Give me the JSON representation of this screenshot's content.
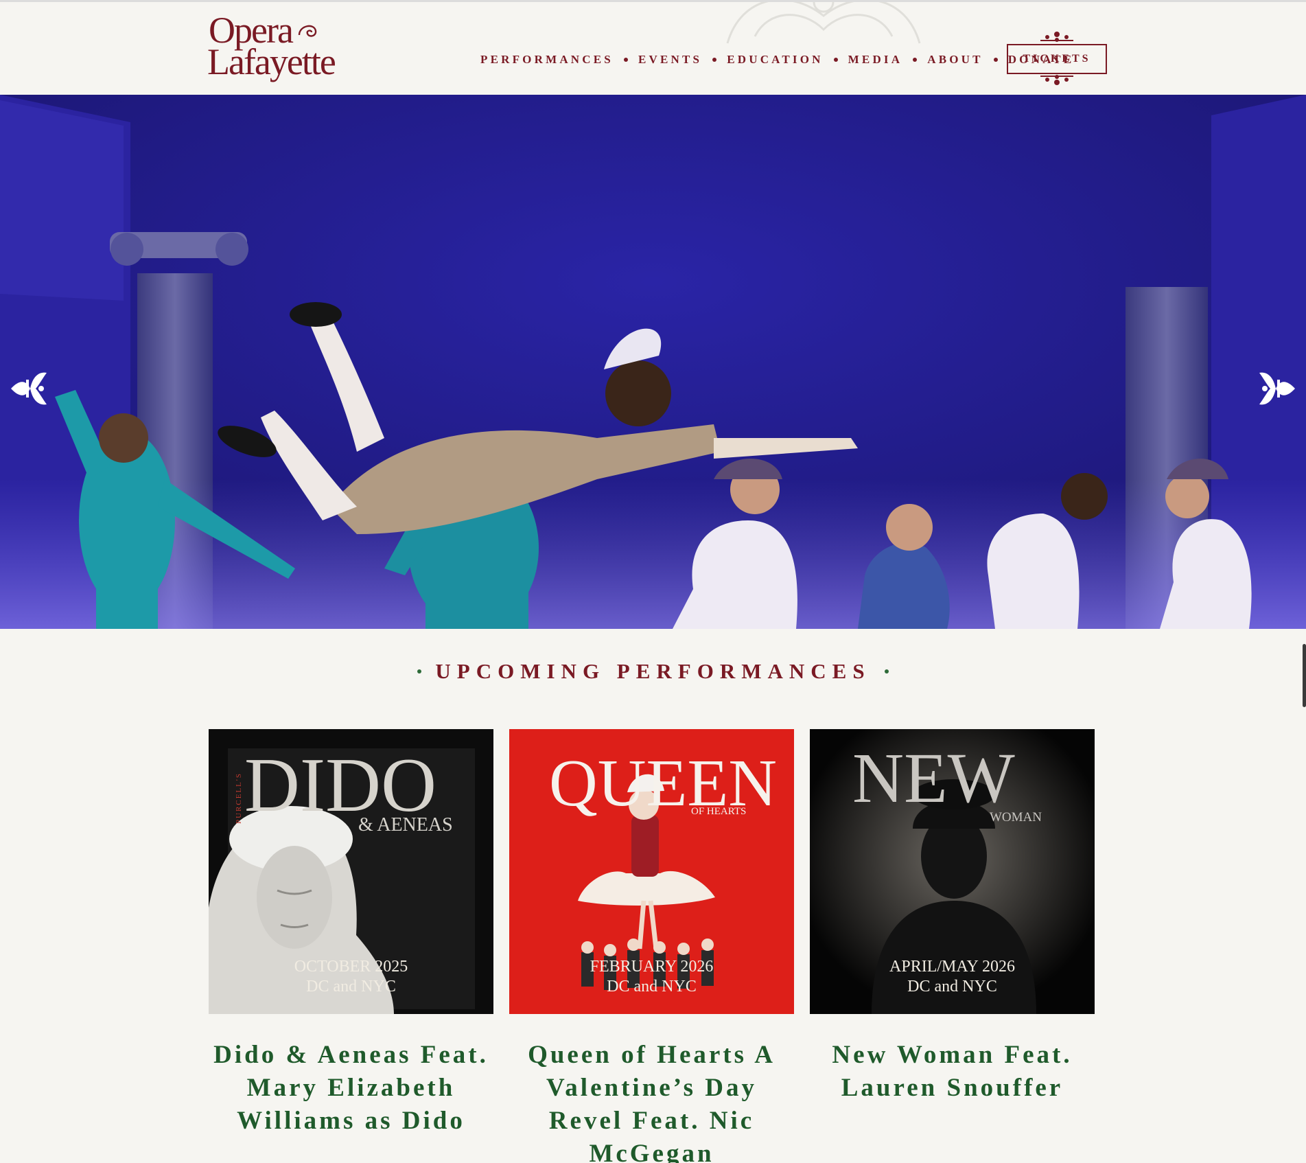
{
  "brand": {
    "logo_line1": "Opera",
    "logo_line2": "Lafayette"
  },
  "nav": {
    "items": [
      "PERFORMANCES",
      "EVENTS",
      "EDUCATION",
      "MEDIA",
      "ABOUT",
      "DONATE"
    ],
    "tickets_label": "TICKETS"
  },
  "hero": {
    "prev_icon": "fleur-de-lis-left-arrow",
    "next_icon": "fleur-de-lis-right-arrow"
  },
  "upcoming": {
    "heading": "UPCOMING PERFORMANCES",
    "cards": [
      {
        "poster_small": "PURCELL'S",
        "poster_title": "DIDO",
        "poster_subtitle": "& AENEAS",
        "date_line1": "OCTOBER 2025",
        "date_line2": "DC and NYC",
        "caption": "Dido & Aeneas Feat. Mary Elizabeth Williams as Dido"
      },
      {
        "poster_title": "QUEEN",
        "poster_subtitle": "OF HEARTS",
        "date_line1": "FEBRUARY 2026",
        "date_line2": "DC and NYC",
        "caption": "Queen of Hearts A Valentine’s Day Revel Feat. Nic McGegan"
      },
      {
        "poster_title": "NEW",
        "poster_subtitle": "WOMAN",
        "date_line1": "APRIL/MAY 2026",
        "date_line2": "DC and NYC",
        "caption": "New Woman Feat. Lauren Snouffer"
      }
    ]
  },
  "colors": {
    "brand": "#7a1a24",
    "accent_green": "#1f5a2b",
    "background": "#f6f5f1",
    "stage_blue": "#211b86"
  }
}
